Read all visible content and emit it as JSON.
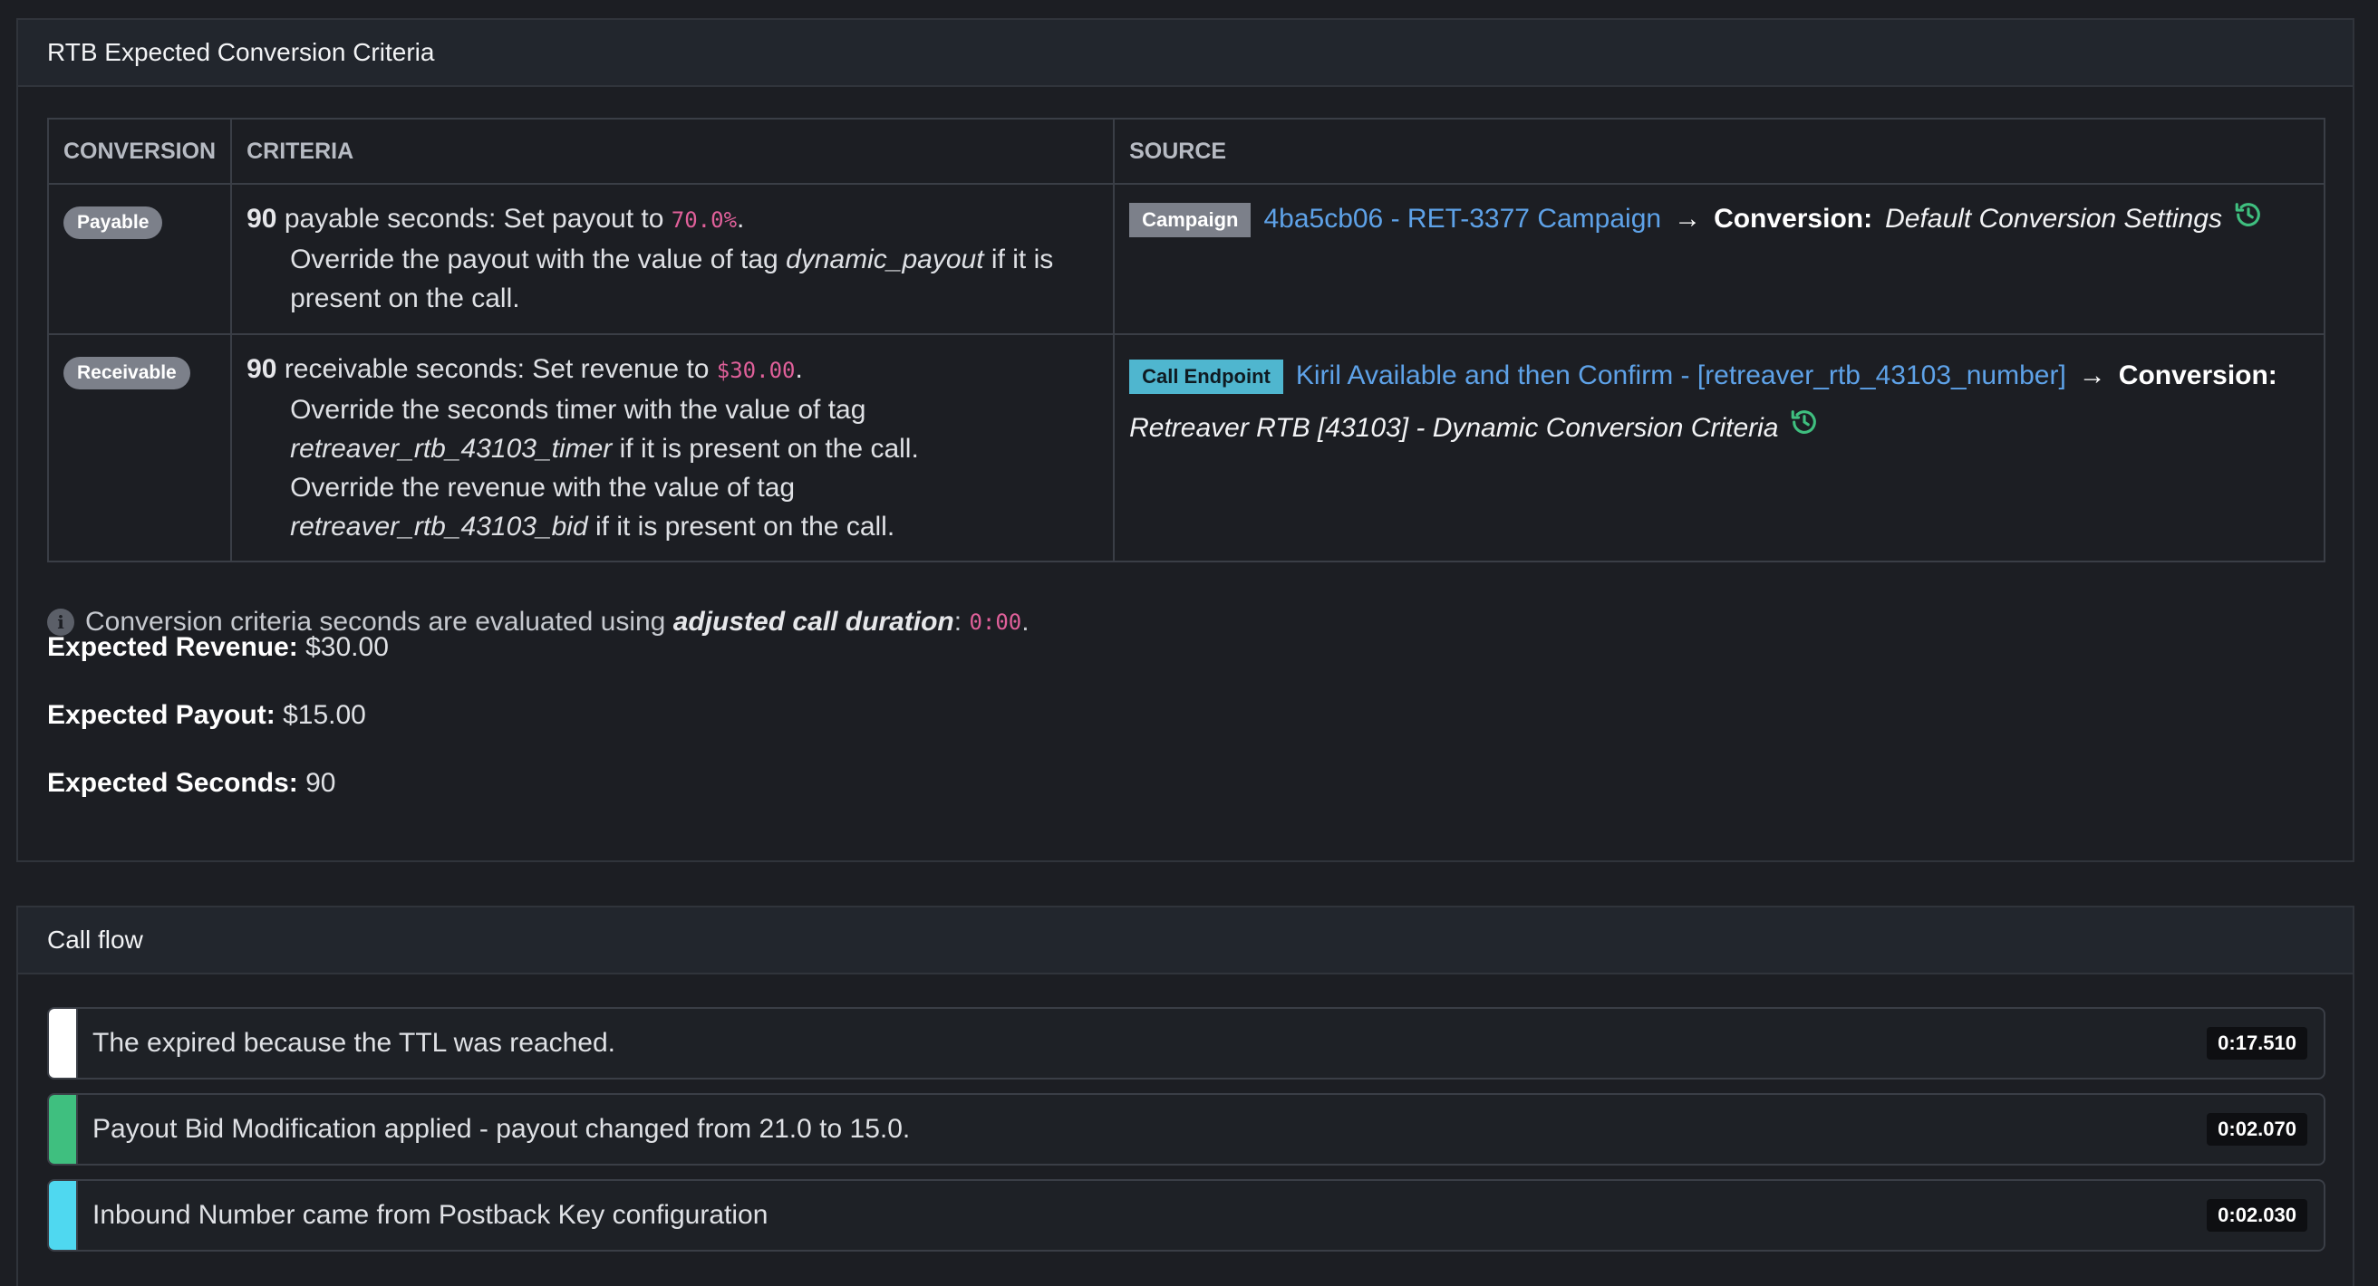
{
  "rtb": {
    "title": "RTB Expected Conversion Criteria",
    "columns": {
      "conversion": "CONVERSION",
      "criteria": "CRITERIA",
      "source": "SOURCE"
    },
    "rows": [
      {
        "pill": "Payable",
        "seconds": "90",
        "line1_text": "payable seconds: Set payout to",
        "line1_value": "70.0%",
        "override1_pre": "Override the payout with the value of tag",
        "override1_tag": "dynamic_payout",
        "override1_post": "if it is present on the call.",
        "source_tag": "Campaign",
        "source_link": "4ba5cb06 - RET-3377 Campaign",
        "arrow": "→",
        "conversion_label": "Conversion:",
        "conversion_name": "Default Conversion Settings"
      },
      {
        "pill": "Receivable",
        "seconds": "90",
        "line1_text": "receivable seconds: Set revenue to",
        "line1_value": "$30.00",
        "override1_pre": "Override the seconds timer with the value of tag",
        "override1_tag": "retreaver_rtb_43103_timer",
        "override1_post": "if it is present on the call.",
        "override2_pre": "Override the revenue with the value of tag",
        "override2_tag": "retreaver_rtb_43103_bid",
        "override2_post": "if it is present on the call.",
        "source_tag": "Call Endpoint",
        "source_link": "Kiril Available and then Confirm - [retreaver_rtb_43103_number]",
        "arrow": "→",
        "conversion_label": "Conversion:",
        "conversion_name": "Retreaver RTB [43103] - Dynamic Conversion Criteria"
      }
    ],
    "note": {
      "text": "Conversion criteria seconds are evaluated using",
      "emphasis": "adjusted call duration",
      "colon": ":",
      "value": "0:00",
      "period": "."
    },
    "expected": {
      "revenue_label": "Expected Revenue:",
      "revenue_value": "$30.00",
      "payout_label": "Expected Payout:",
      "payout_value": "$15.00",
      "seconds_label": "Expected Seconds:",
      "seconds_value": "90"
    },
    "colors": {
      "link": "#5ea2e8",
      "code": "#e0609a",
      "history_icon": "#3fbf7f",
      "endpoint_tag": "#4fb6cf"
    },
    "icons": {
      "history": "history-icon",
      "info": "info-icon"
    }
  },
  "flow": {
    "title": "Call flow",
    "rows": [
      {
        "color": "#ffffff",
        "text": "The expired because the TTL was reached.",
        "time": "0:17.510"
      },
      {
        "color": "#3fbf7f",
        "text": "Payout Bid Modification applied - payout changed from 21.0 to 15.0.",
        "time": "0:02.070"
      },
      {
        "color": "#4fd8f0",
        "text": "Inbound Number came from Postback Key configuration",
        "time": "0:02.030"
      }
    ]
  }
}
